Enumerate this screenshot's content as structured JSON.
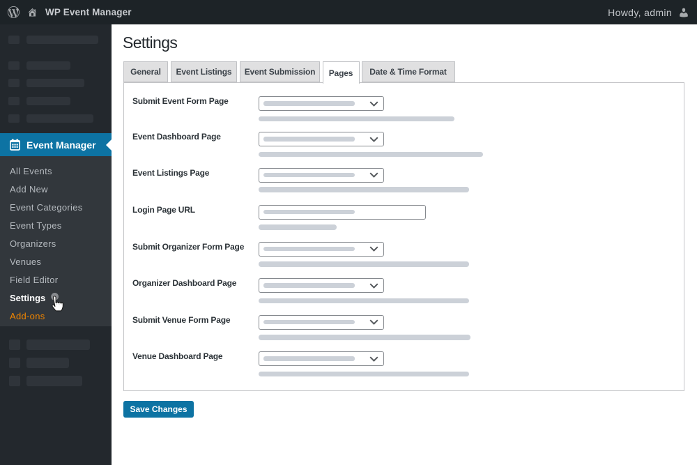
{
  "admin_bar": {
    "site_name": "WP Event Manager",
    "howdy": "Howdy, admin"
  },
  "sidebar": {
    "menu": {
      "label": "Event Manager",
      "icon": "calendar-icon",
      "active": true
    },
    "submenu": [
      {
        "label": "All Events"
      },
      {
        "label": "Add New"
      },
      {
        "label": "Event Categories"
      },
      {
        "label": "Event Types"
      },
      {
        "label": "Organizers"
      },
      {
        "label": "Venues"
      },
      {
        "label": "Field Editor"
      },
      {
        "label": "Settings",
        "current": true
      },
      {
        "label": "Add-ons",
        "highlight_color": "#f18500"
      }
    ]
  },
  "content": {
    "title": "Settings",
    "tabs": [
      {
        "label": "General",
        "active": false
      },
      {
        "label": "Event Listings",
        "active": false
      },
      {
        "label": "Event Submission",
        "active": false
      },
      {
        "label": "Pages",
        "active": true
      },
      {
        "label": "Date & Time Format",
        "active": false
      }
    ],
    "form": {
      "rows": [
        {
          "label": "Submit Event Form Page",
          "control": "select",
          "value": ""
        },
        {
          "label": "Event Dashboard Page",
          "control": "select",
          "value": ""
        },
        {
          "label": "Event Listings Page",
          "control": "select",
          "value": ""
        },
        {
          "label": "Login Page URL",
          "control": "text-input",
          "value": "",
          "placeholder": ""
        },
        {
          "label": "Submit Organizer Form Page",
          "control": "select",
          "value": ""
        },
        {
          "label": "Organizer Dashboard Page",
          "control": "select",
          "value": ""
        },
        {
          "label": "Submit Venue Form Page",
          "control": "select",
          "value": ""
        },
        {
          "label": "Venue Dashboard Page",
          "control": "select",
          "value": ""
        }
      ]
    },
    "save_button": "Save Changes"
  },
  "colors": {
    "admin_bar_bg": "#1d2327",
    "sidebar_bg": "#23282d",
    "submenu_bg": "#32373c",
    "accent_blue": "#0d73a3",
    "addons_orange": "#f18500",
    "panel_border": "#c3c4c7",
    "placeholder_gray": "#ccd1d8"
  }
}
